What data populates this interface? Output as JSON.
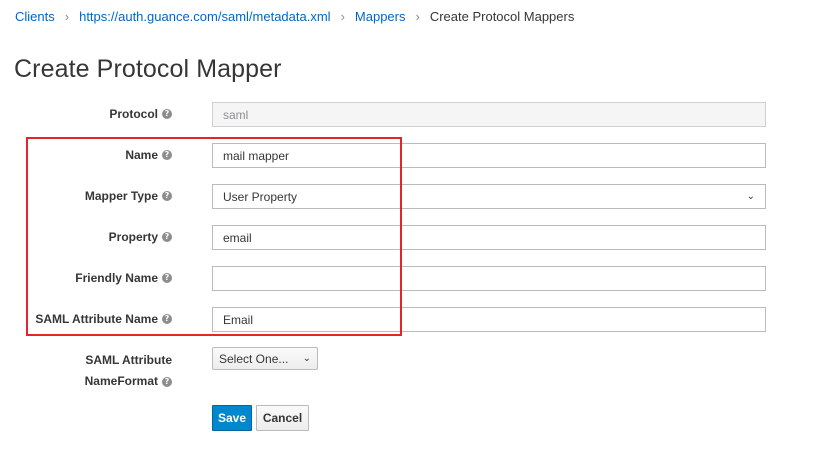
{
  "breadcrumb": {
    "items": [
      "Clients",
      "https://auth.guance.com/saml/metadata.xml",
      "Mappers"
    ],
    "current": "Create Protocol Mappers"
  },
  "page_title": "Create Protocol Mapper",
  "form": {
    "protocol": {
      "label": "Protocol",
      "value": "saml"
    },
    "name": {
      "label": "Name",
      "value": "mail mapper"
    },
    "mapper_type": {
      "label": "Mapper Type",
      "value": "User Property"
    },
    "property": {
      "label": "Property",
      "value": "email"
    },
    "friendly_name": {
      "label": "Friendly Name",
      "value": ""
    },
    "saml_attribute_name": {
      "label": "SAML Attribute Name",
      "value": "Email"
    },
    "saml_attribute_nameformat": {
      "label_line1": "SAML Attribute",
      "label_line2": "NameFormat",
      "value": "Select One..."
    }
  },
  "buttons": {
    "save": "Save",
    "cancel": "Cancel"
  },
  "colors": {
    "link": "#0066cc",
    "primary": "#0088ce",
    "highlight": "#e0262b"
  },
  "icons": {
    "help": "question-circle-icon",
    "dropdown": "chevron-down-icon"
  }
}
